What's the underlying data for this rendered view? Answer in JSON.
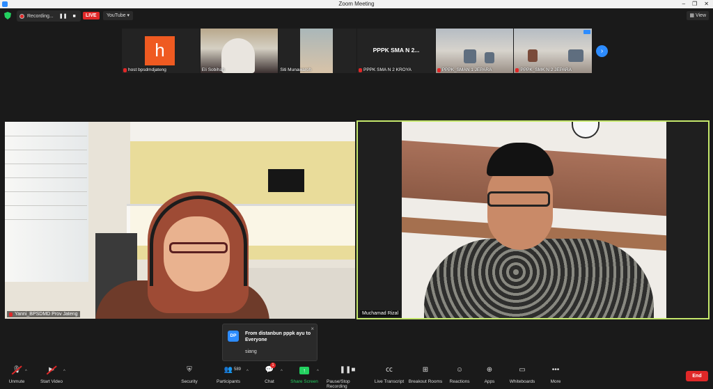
{
  "window": {
    "title": "Zoom Meeting",
    "controls": [
      "–",
      "❐",
      "✕"
    ]
  },
  "topbar": {
    "recording_label": "Recording...",
    "pause_icon": "❚❚",
    "stop_icon": "■",
    "live_label": "LIVE",
    "stream_target": "YouTube ▾",
    "view_label": "View"
  },
  "participants_strip": [
    {
      "name": "host bpsdmdjateng",
      "tile": "logo",
      "logo_letter": "h"
    },
    {
      "name": "Eli Sobihah",
      "tile": "camera"
    },
    {
      "name": "Siti Munawaroh",
      "tile": "camera"
    },
    {
      "name": "PPPK SMA N 2 KROYA",
      "tile": "text",
      "tile_text": "PPPK SMA N 2..."
    },
    {
      "name": "PPPK_SMAN 1 JEPARA",
      "tile": "camera"
    },
    {
      "name": "PPPK_SMK N 2 JEPARA",
      "tile": "camera"
    }
  ],
  "strip_next_icon": "›",
  "main_videos": {
    "left_name": "Yanni_BPSDMD Prov Jateng",
    "right_name": "Muchamad Rizal"
  },
  "chat_toast": {
    "avatar": "DP",
    "from": "From distanbun pppk ayu to Everyone",
    "message": "siang",
    "close": "×"
  },
  "toolbar": {
    "unmute": "Unmute",
    "start_video": "Start Video",
    "security": "Security",
    "participants": "Participants",
    "participants_count": "589",
    "chat": "Chat",
    "chat_badge": "1",
    "share_screen": "Share Screen",
    "pause_recording": "Pause/Stop Recording",
    "live_transcript": "Live Transcript",
    "breakout_rooms": "Breakout Rooms",
    "reactions": "Reactions",
    "apps": "Apps",
    "whiteboards": "Whiteboards",
    "more": "More",
    "end": "End"
  },
  "colors": {
    "accent": "#2d8cff",
    "active_speaker_border": "#c5e86c",
    "end_red": "#e02828",
    "share_green": "#23d160"
  }
}
